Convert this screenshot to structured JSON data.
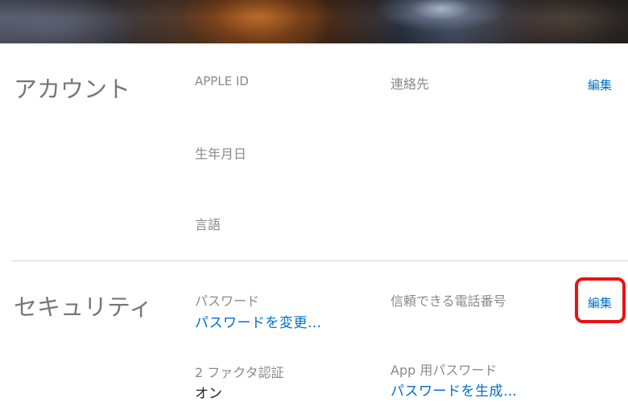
{
  "banner": {
    "image": "blurred-photo-banner"
  },
  "account": {
    "title": "アカウント",
    "apple_id_label": "APPLE ID",
    "contact_label": "連絡先",
    "edit_label": "編集",
    "birthday_label": "生年月日",
    "language_label": "言語"
  },
  "security": {
    "title": "セキュリティ",
    "password_label": "パスワード",
    "change_password_link": "パスワードを変更…",
    "trusted_phone_label": "信頼できる電話番号",
    "edit_label": "編集",
    "two_factor_label": "2 ファクタ認証",
    "two_factor_value": "オン",
    "app_password_label": "App 用パスワード",
    "generate_password_link": "パスワードを生成…"
  },
  "colors": {
    "link": "#0070c9",
    "highlight": "#ee1111",
    "divider": "#d6d6d6"
  }
}
